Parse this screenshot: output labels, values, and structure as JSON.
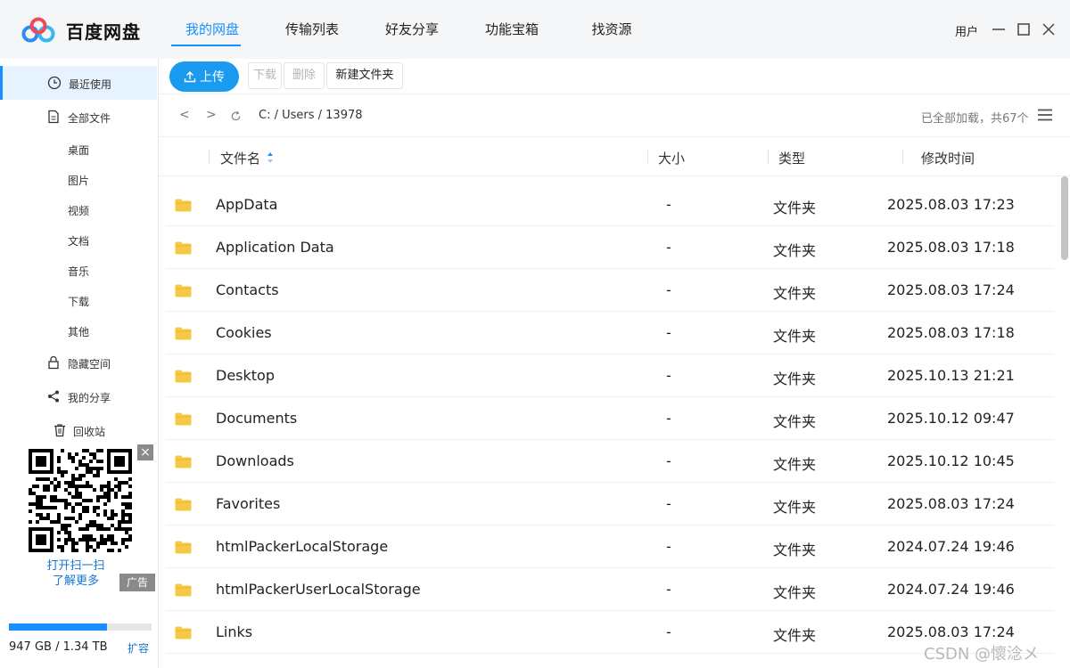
{
  "app": {
    "title": "百度网盘",
    "user": "用户"
  },
  "nav": [
    "我的网盘",
    "传输列表",
    "好友分享",
    "功能宝箱",
    "找资源"
  ],
  "sidebar": {
    "items": [
      {
        "label": "最近使用",
        "icon": "clock-icon"
      },
      {
        "label": "全部文件",
        "icon": "file-icon"
      }
    ],
    "subitems": [
      "桌面",
      "图片",
      "视频",
      "文档",
      "音乐",
      "下载",
      "其他"
    ],
    "extra": [
      {
        "label": "隐藏空间",
        "icon": "lock-icon"
      },
      {
        "label": "我的分享",
        "icon": "share-icon"
      },
      {
        "label": "回收站",
        "icon": "trash-icon"
      }
    ],
    "ad": {
      "close": "×",
      "line1": "打开扫一扫",
      "line2": "了解更多",
      "tag": "广告"
    },
    "quota": {
      "text": "947 GB / 1.34 TB",
      "used_fraction": 0.69,
      "expand": "扩容"
    }
  },
  "toolbar": {
    "upload": "上传",
    "download": "下载",
    "delete": "删除",
    "new_folder": "新建文件夹"
  },
  "pathbar": {
    "back": "<",
    "forward": ">",
    "path": "C: / Users / 13978",
    "loaded": "已全部加载，共67个"
  },
  "table": {
    "headers": {
      "name": "文件名",
      "size": "大小",
      "type": "类型",
      "modified": "修改时间"
    },
    "rows": [
      {
        "name": "AppData",
        "size": "-",
        "type": "文件夹",
        "modified": "2025.08.03 17:23"
      },
      {
        "name": "Application Data",
        "size": "-",
        "type": "文件夹",
        "modified": "2025.08.03 17:18"
      },
      {
        "name": "Contacts",
        "size": "-",
        "type": "文件夹",
        "modified": "2025.08.03 17:24"
      },
      {
        "name": "Cookies",
        "size": "-",
        "type": "文件夹",
        "modified": "2025.08.03 17:18"
      },
      {
        "name": "Desktop",
        "size": "-",
        "type": "文件夹",
        "modified": "2025.10.13 21:21"
      },
      {
        "name": "Documents",
        "size": "-",
        "type": "文件夹",
        "modified": "2025.10.12 09:47"
      },
      {
        "name": "Downloads",
        "size": "-",
        "type": "文件夹",
        "modified": "2025.10.12 10:45"
      },
      {
        "name": "Favorites",
        "size": "-",
        "type": "文件夹",
        "modified": "2025.08.03 17:24"
      },
      {
        "name": "htmlPackerLocalStorage",
        "size": "-",
        "type": "文件夹",
        "modified": "2024.07.24 19:46"
      },
      {
        "name": "htmlPackerUserLocalStorage",
        "size": "-",
        "type": "文件夹",
        "modified": "2024.07.24 19:46"
      },
      {
        "name": "Links",
        "size": "-",
        "type": "文件夹",
        "modified": "2025.08.03 17:24"
      }
    ]
  },
  "watermark": "CSDN @懷淰メ",
  "colors": {
    "accent": "#1890ff",
    "folder": "#f7c843"
  }
}
